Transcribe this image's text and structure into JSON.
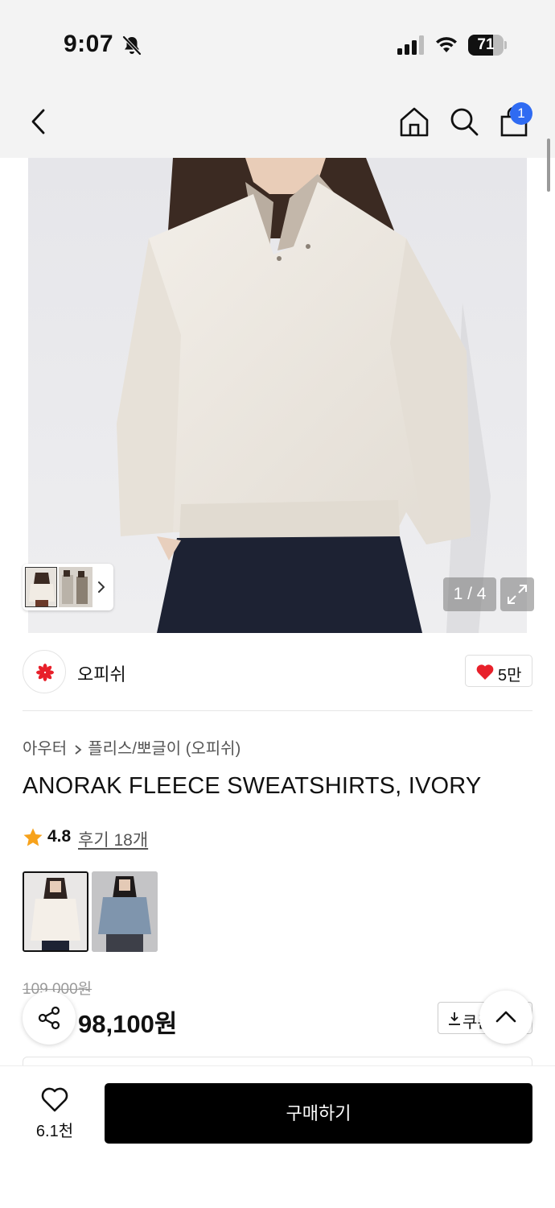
{
  "status_bar": {
    "time": "9:07",
    "battery_level": "71",
    "icons": [
      "bell-muted-icon",
      "cellular-signal-icon",
      "wifi-icon",
      "battery-icon"
    ]
  },
  "nav": {
    "icons": [
      "back-arrow-icon",
      "home-icon",
      "search-icon",
      "shopping-bag-icon"
    ],
    "cart_badge": "1"
  },
  "gallery": {
    "counter": "1 / 4",
    "icons": [
      "chevron-right-icon",
      "expand-icon"
    ]
  },
  "brand": {
    "name": "오피쉬",
    "likes": "5만",
    "icons": [
      "brand-logo",
      "heart-filled-icon"
    ]
  },
  "breadcrumb": {
    "category": "아우터",
    "subcategory": "플리스/뽀글이 (오피쉬)"
  },
  "product": {
    "title": "ANORAK FLEECE SWEATSHIRTS, IVORY",
    "rating": "4.8",
    "reviews": "후기 18개",
    "original_price": "109,000원",
    "sale_price": "98,100원",
    "coupon_label": "쿠폰",
    "color_options": [
      "ivory",
      "blue"
    ]
  },
  "bottom_bar": {
    "favorite_count": "6.1천",
    "buy_label": "구매하기"
  },
  "colors": {
    "badge_blue": "#2f6bf2",
    "heart_red": "#e8202a",
    "star_orange": "#f7a21b",
    "buy_button": "#000000"
  }
}
